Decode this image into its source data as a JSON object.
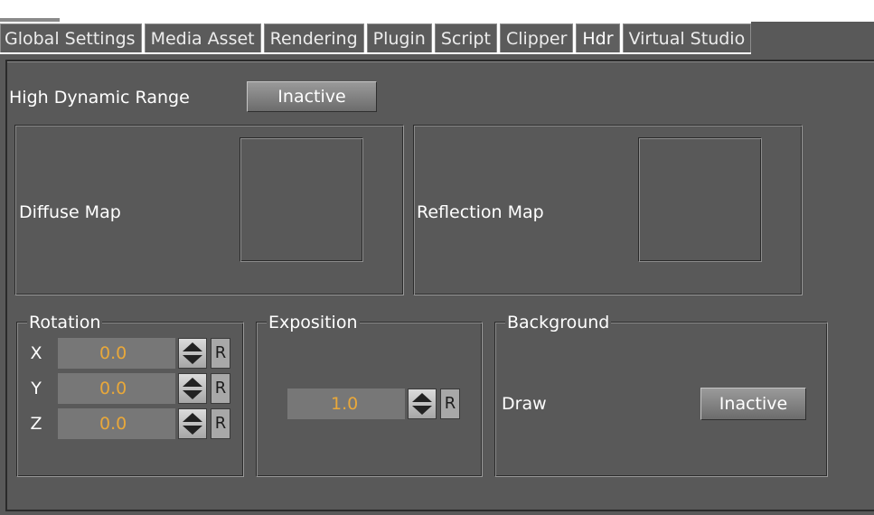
{
  "tabs": [
    {
      "label": "Global Settings"
    },
    {
      "label": "Media Asset"
    },
    {
      "label": "Rendering"
    },
    {
      "label": "Plugin"
    },
    {
      "label": "Script"
    },
    {
      "label": "Clipper"
    },
    {
      "label": "Hdr"
    },
    {
      "label": "Virtual Studio"
    }
  ],
  "active_tab": "Hdr",
  "hdr": {
    "label": "High Dynamic Range",
    "toggle": "Inactive"
  },
  "maps": {
    "diffuse_label": "Diffuse Map",
    "reflection_label": "Reflection Map"
  },
  "rotation": {
    "title": "Rotation",
    "rows": [
      {
        "axis": "X",
        "value": "0.0",
        "reset": "R"
      },
      {
        "axis": "Y",
        "value": "0.0",
        "reset": "R"
      },
      {
        "axis": "Z",
        "value": "0.0",
        "reset": "R"
      }
    ]
  },
  "exposition": {
    "title": "Exposition",
    "value": "1.0",
    "reset": "R"
  },
  "background": {
    "title": "Background",
    "draw_label": "Draw",
    "draw_toggle": "Inactive"
  },
  "colors": {
    "value_text": "#e9a83a",
    "panel_bg": "#595959"
  }
}
